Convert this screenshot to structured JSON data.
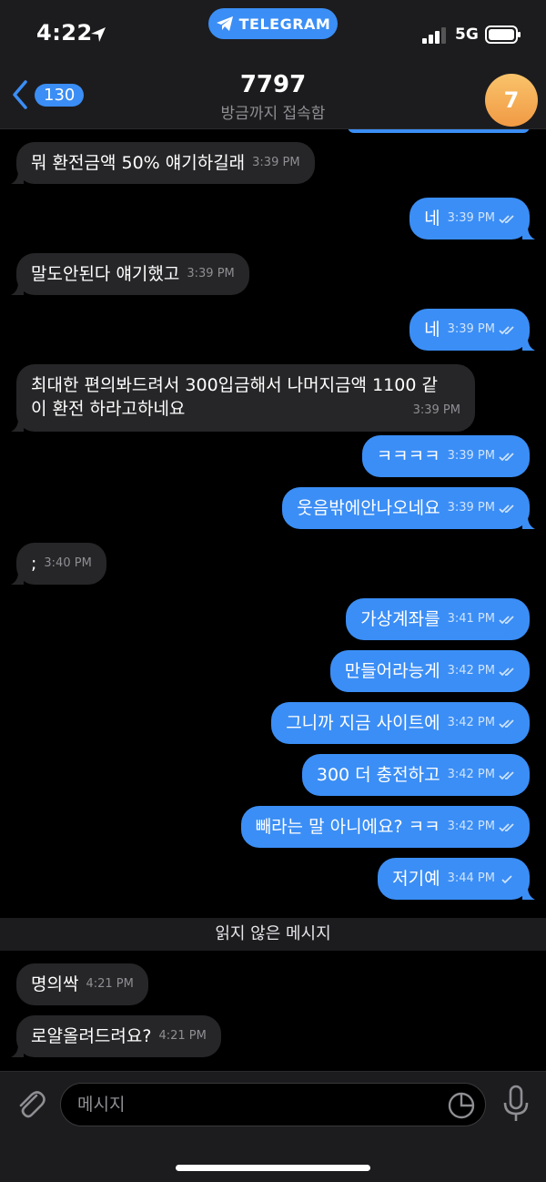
{
  "status": {
    "time": "4:22",
    "app_pill": "TELEGRAM",
    "network": "5G"
  },
  "header": {
    "back_count": "130",
    "title": "7797",
    "subtitle": "방금까지 접속함",
    "avatar_letter": "7"
  },
  "messages": [
    {
      "dir": "in",
      "text": "뭐 환전금액 50% 얘기하길래",
      "time": "3:39 PM"
    },
    {
      "dir": "out",
      "text": "네",
      "time": "3:39 PM"
    },
    {
      "dir": "in",
      "text": "말도안된다 얘기했고",
      "time": "3:39 PM"
    },
    {
      "dir": "out",
      "text": "네",
      "time": "3:39 PM"
    },
    {
      "dir": "in",
      "line1": "최대한 편의봐드려서 300입금해서 나머지금액 1100 같",
      "line2": "이 환전 하라고하네요",
      "time": "3:39 PM"
    },
    {
      "dir": "out",
      "text": "ㅋㅋㅋㅋ",
      "time": "3:39 PM"
    },
    {
      "dir": "out",
      "text": "웃음밖에안나오네요",
      "time": "3:39 PM"
    },
    {
      "dir": "in",
      "text": ";",
      "time": "3:40 PM"
    },
    {
      "dir": "out",
      "text": "가상계좌를",
      "time": "3:41 PM"
    },
    {
      "dir": "out",
      "text": "만들어라능게",
      "time": "3:42 PM"
    },
    {
      "dir": "out",
      "text": "그니까 지금 사이트에",
      "time": "3:42 PM"
    },
    {
      "dir": "out",
      "text": "300 더 충전하고",
      "time": "3:42 PM"
    },
    {
      "dir": "out",
      "text": "빼라는 말 아니에요? ㅋㅋ",
      "time": "3:42 PM"
    },
    {
      "dir": "out",
      "text": "저기예",
      "time": "3:44 PM"
    },
    {
      "dir": "in",
      "text": "명의싹",
      "time": "4:21 PM"
    },
    {
      "dir": "in",
      "text": "로얄올려드려요?",
      "time": "4:21 PM"
    }
  ],
  "unread_label": "읽지 않은 메시지",
  "input": {
    "placeholder": "메시지"
  },
  "colors": {
    "accent": "#3b8ef5",
    "incoming": "#262628",
    "bar": "#1c1c1e",
    "avatar": "#f19a44"
  }
}
